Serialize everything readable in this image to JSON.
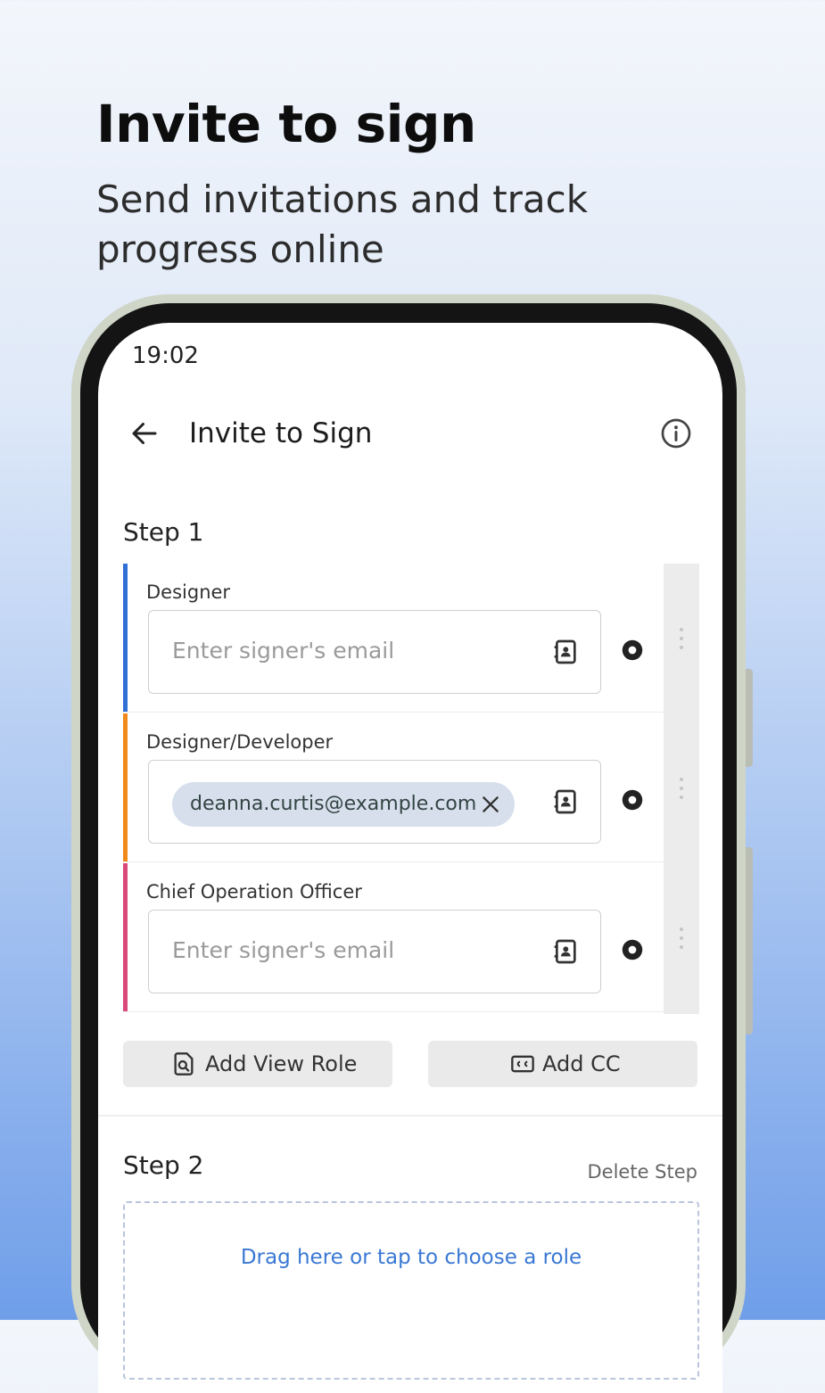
{
  "promo": {
    "headline": "Invite to sign",
    "subline": "Send invitations and track progress online"
  },
  "status_bar": {
    "time": "19:02"
  },
  "app_bar": {
    "title": "Invite to Sign",
    "back_icon": "arrow-left-icon",
    "info_icon": "info-icon"
  },
  "steps": [
    {
      "label": "Step 1",
      "roles": [
        {
          "name": "Designer",
          "color": "#2f6fd6",
          "email_placeholder": "Enter signer's email",
          "email": ""
        },
        {
          "name": "Designer/Developer",
          "color": "#f08a1c",
          "email_placeholder": "Enter signer's email",
          "email": "deanna.curtis@example.com"
        },
        {
          "name": "Chief Operation Officer",
          "color": "#d94a7a",
          "email_placeholder": "Enter signer's email",
          "email": ""
        }
      ],
      "actions": {
        "add_view_role": "Add View Role",
        "add_cc": "Add CC"
      }
    },
    {
      "label": "Step 2",
      "delete_label": "Delete Step",
      "dropzone_text": "Drag here or tap to choose a role"
    }
  ],
  "colors": {
    "accent": "#3a78d4",
    "background_top": "#f3f6fb",
    "background_bottom": "#6f9ee9"
  }
}
